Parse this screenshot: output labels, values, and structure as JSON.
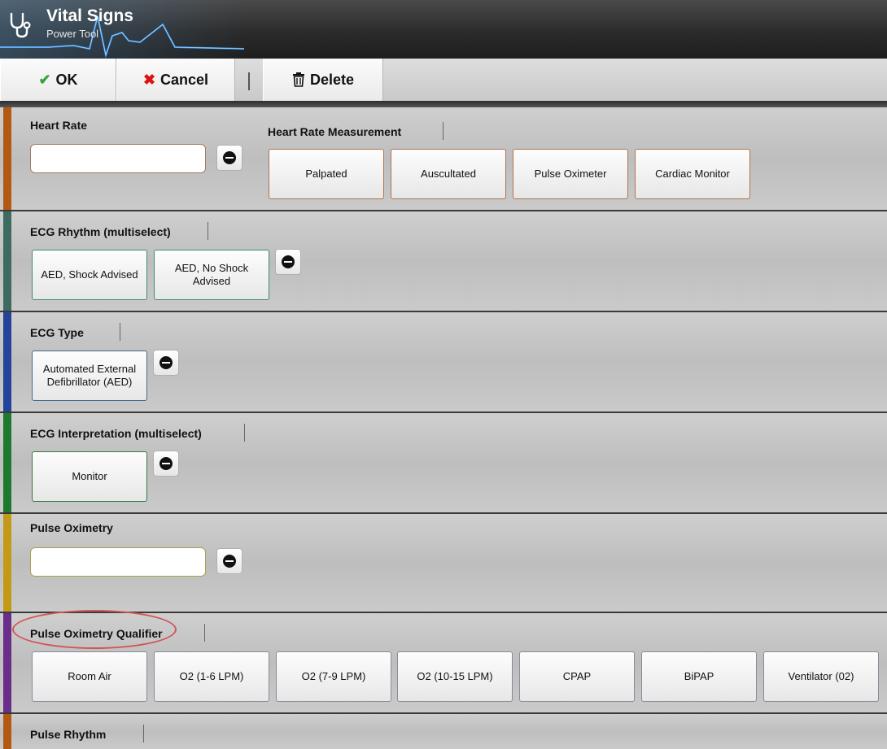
{
  "header": {
    "title": "Vital Signs",
    "subtitle": "Power Tool"
  },
  "toolbar": {
    "ok_label": "OK",
    "cancel_label": "Cancel",
    "delete_label": "Delete"
  },
  "colors": {
    "heart_rate_bar": "#b35a12",
    "ecg_rhythm_bar": "#3c6b62",
    "ecg_type_bar": "#23449a",
    "ecg_interp_bar": "#1d7a2c",
    "pulse_ox_bar": "#c39a18",
    "pulse_ox_qual_bar": "#6b2d8a",
    "pulse_rhythm_bar": "#b35a12",
    "ok_check": "#3aa43a",
    "cancel_x": "#d11",
    "highlight": "#d25555"
  },
  "sections": {
    "heart_rate": {
      "label": "Heart Rate",
      "value": "",
      "measurement_label": "Heart Rate Measurement",
      "options": [
        "Palpated",
        "Auscultated",
        "Pulse Oximeter",
        "Cardiac Monitor"
      ]
    },
    "ecg_rhythm": {
      "label": "ECG Rhythm (multiselect)",
      "options": [
        "AED, Shock Advised",
        "AED, No Shock Advised"
      ]
    },
    "ecg_type": {
      "label": "ECG Type",
      "options": [
        "Automated External Defibrillator (AED)"
      ]
    },
    "ecg_interpretation": {
      "label": "ECG Interpretation (multiselect)",
      "options": [
        "Monitor"
      ]
    },
    "pulse_oximetry": {
      "label": "Pulse Oximetry",
      "value": ""
    },
    "pulse_oximetry_qualifier": {
      "label": "Pulse Oximetry Qualifier",
      "options": [
        "Room Air",
        "O2 (1-6 LPM)",
        "O2 (7-9 LPM)",
        "O2 (10-15 LPM)",
        "CPAP",
        "BiPAP",
        "Ventilator (02)"
      ]
    },
    "pulse_rhythm": {
      "label": "Pulse Rhythm"
    }
  }
}
